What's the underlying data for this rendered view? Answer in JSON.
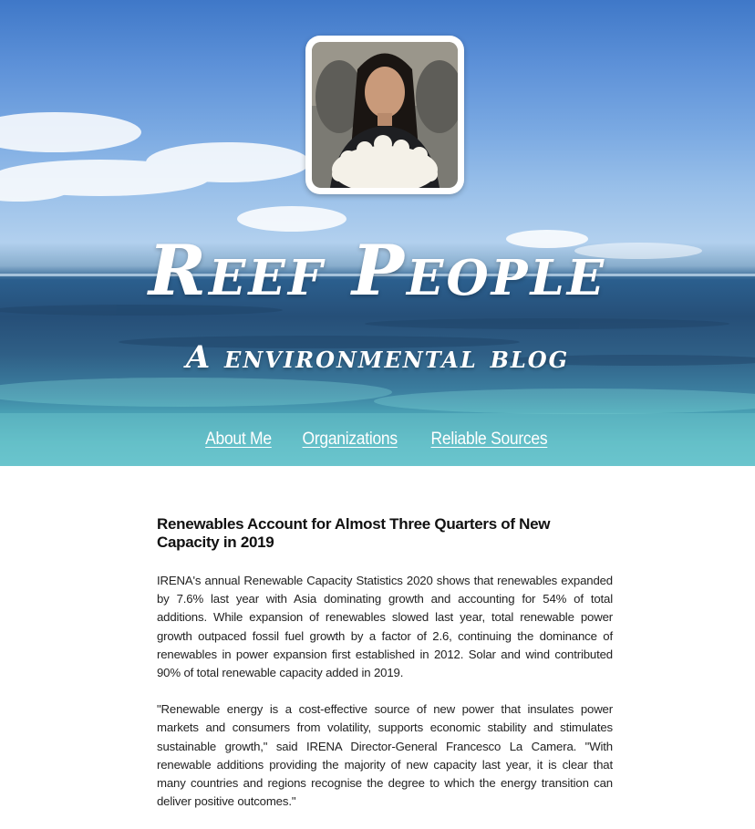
{
  "header": {
    "title": "Reef People",
    "subtitle": "A environmental blog"
  },
  "avatar": {
    "alt": "Blogger holding white coral"
  },
  "nav": {
    "items": [
      {
        "label": "About Me"
      },
      {
        "label": "Organizations"
      },
      {
        "label": "Reliable Sources"
      }
    ]
  },
  "article": {
    "title": "Renewables Account for Almost Three Quarters of New Capacity in 2019",
    "paragraphs": [
      "IRENA's annual Renewable Capacity Statistics 2020 shows that renewables expanded by 7.6% last year with Asia dominating growth and accounting for 54% of total additions. While expansion of renewables slowed last year, total renewable power growth outpaced fossil fuel growth by a factor of 2.6, continuing the dominance of renewables in power expansion first established in 2012. Solar and wind contributed 90% of total renewable capacity added in 2019.",
      "\"Renewable energy is a cost-effective source of new power that insulates power markets and consumers from volatility, supports economic stability and stimulates sustainable growth,\" said IRENA Director-General Francesco La Camera. \"With renewable additions providing the majority of new capacity last year, it is clear that many countries and regions recognise the degree to which the energy transition can deliver positive outcomes.\""
    ]
  },
  "colors": {
    "sky_top": "#3f78c8",
    "ocean": "#264f78",
    "shallows": "#63c0cb",
    "text": "#222222"
  }
}
